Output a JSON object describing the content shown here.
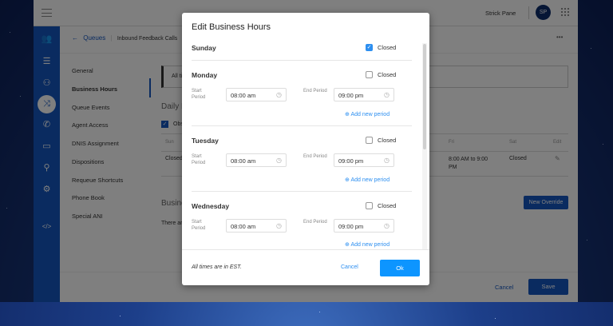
{
  "topbar": {
    "user_name": "Strick Pane",
    "avatar_initials": "SP"
  },
  "breadcrumb": {
    "back": "Queues",
    "current": "Inbound Feedback Calls"
  },
  "sidebar_icons": [
    "users-icon",
    "sliders-icon",
    "org-chart-icon",
    "shuffle-icon",
    "phone-forward-icon",
    "chat-icon",
    "user-key-icon",
    "gear-icon",
    "code-icon"
  ],
  "nav": {
    "items": [
      "General",
      "Business Hours",
      "Queue Events",
      "Agent Access",
      "DNIS Assignment",
      "Dispositions",
      "Requeue Shortcuts",
      "Phone Book",
      "Special ANI"
    ],
    "active": "Business Hours"
  },
  "content": {
    "notice": "All ti",
    "daily_heading": "Daily B",
    "observe_label": "Obs",
    "table_headers": {
      "sun": "Sun",
      "fri": "Fri",
      "sat": "Sat",
      "edit": "Edit"
    },
    "row": {
      "sun": "Closed",
      "fri": "8:00 AM to 9:00 PM",
      "sat": "Closed"
    },
    "overrides_heading": "Busine",
    "overrides_empty": "There ar",
    "new_override": "New Override"
  },
  "footer": {
    "cancel": "Cancel",
    "save": "Save"
  },
  "modal": {
    "title": "Edit Business Hours",
    "closed_label": "Closed",
    "start_label": "Start Period",
    "end_label": "End Period",
    "add_period": "Add new period",
    "days": [
      {
        "name": "Sunday",
        "closed": true
      },
      {
        "name": "Monday",
        "closed": false,
        "start": "08:00 am",
        "end": "09:00 pm"
      },
      {
        "name": "Tuesday",
        "closed": false,
        "start": "08:00 am",
        "end": "09:00 pm"
      },
      {
        "name": "Wednesday",
        "closed": false,
        "start": "08:00 am",
        "end": "09:00 pm"
      }
    ],
    "note": "All times are in EST.",
    "cancel": "Cancel",
    "ok": "Ok"
  },
  "colors": {
    "primary": "#1557c0",
    "accent": "#2d8ff0"
  }
}
